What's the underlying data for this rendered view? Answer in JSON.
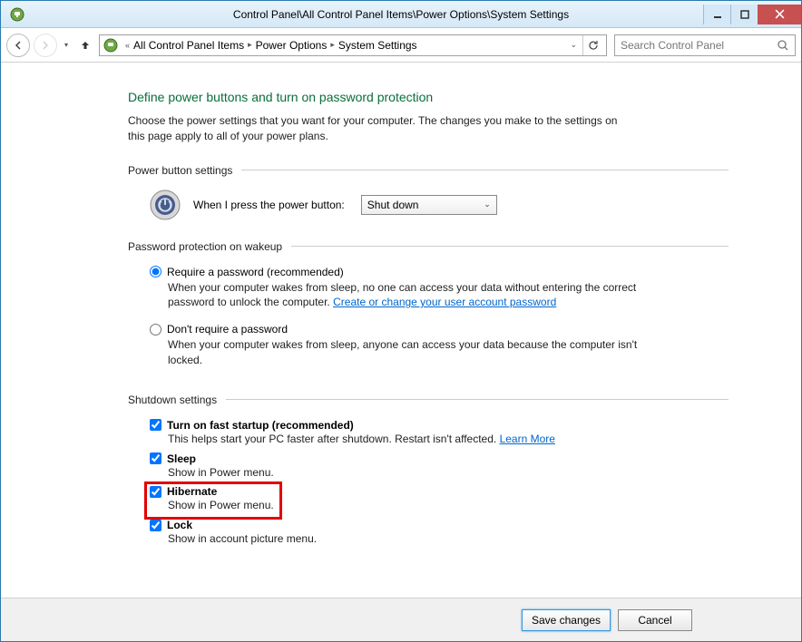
{
  "window": {
    "title": "Control Panel\\All Control Panel Items\\Power Options\\System Settings"
  },
  "breadcrumb": {
    "items": [
      "All Control Panel Items",
      "Power Options",
      "System Settings"
    ]
  },
  "search": {
    "placeholder": "Search Control Panel"
  },
  "page": {
    "title": "Define power buttons and turn on password protection",
    "desc": "Choose the power settings that you want for your computer. The changes you make to the settings on this page apply to all of your power plans."
  },
  "sections": {
    "power_button": {
      "title": "Power button settings",
      "label": "When I press the power button:",
      "selected": "Shut down"
    },
    "password": {
      "title": "Password protection on wakeup",
      "require": {
        "label": "Require a password (recommended)",
        "desc_prefix": "When your computer wakes from sleep, no one can access your data without entering the correct password to unlock the computer. ",
        "link": "Create or change your user account password"
      },
      "dont_require": {
        "label": "Don't require a password",
        "desc": "When your computer wakes from sleep, anyone can access your data because the computer isn't locked."
      }
    },
    "shutdown": {
      "title": "Shutdown settings",
      "fast_startup": {
        "label": "Turn on fast startup (recommended)",
        "desc_prefix": "This helps start your PC faster after shutdown. Restart isn't affected. ",
        "link": "Learn More"
      },
      "sleep": {
        "label": "Sleep",
        "desc": "Show in Power menu."
      },
      "hibernate": {
        "label": "Hibernate",
        "desc": "Show in Power menu."
      },
      "lock": {
        "label": "Lock",
        "desc": "Show in account picture menu."
      }
    }
  },
  "footer": {
    "save": "Save changes",
    "cancel": "Cancel"
  }
}
